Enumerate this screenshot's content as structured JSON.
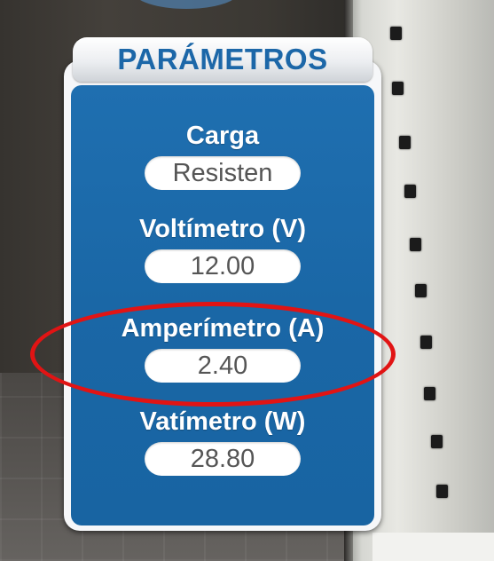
{
  "panel": {
    "title": "PARÁMETROS",
    "colors": {
      "panel_blue": "#1a67a6",
      "title_blue": "#1c67a8",
      "value_text": "#555555",
      "highlight_red": "#e11414"
    },
    "params": [
      {
        "label": "Carga",
        "value": "Resisten"
      },
      {
        "label": "Voltímetro (V)",
        "value": "12.00"
      },
      {
        "label": "Amperímetro (A)",
        "value": "2.40"
      },
      {
        "label": "Vatímetro (W)",
        "value": "28.80"
      }
    ]
  }
}
